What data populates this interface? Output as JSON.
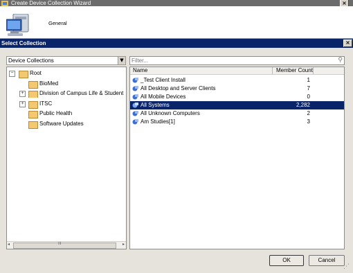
{
  "wizard": {
    "title": "Create Device Collection Wizard",
    "page_label": "General"
  },
  "dialog": {
    "title": "Select Collection"
  },
  "dropdown": {
    "value": "Device Collections"
  },
  "filter": {
    "placeholder": "Filter..."
  },
  "tree": {
    "root": "Root",
    "items": [
      {
        "label": "BioMed",
        "expandable": false
      },
      {
        "label": "Division of Campus Life & Student S",
        "expandable": true
      },
      {
        "label": "ITSC",
        "expandable": true
      },
      {
        "label": "Public Health",
        "expandable": false
      },
      {
        "label": "Software Updates",
        "expandable": false
      }
    ]
  },
  "list": {
    "columns": {
      "name": "Name",
      "count": "Member Count"
    },
    "rows": [
      {
        "name": "_Test Client Install",
        "count": "1"
      },
      {
        "name": "All Desktop and Server Clients",
        "count": "7"
      },
      {
        "name": "All Mobile Devices",
        "count": "0"
      },
      {
        "name": "All Systems",
        "count": "2,282",
        "selected": true
      },
      {
        "name": "All Unknown Computers",
        "count": "2"
      },
      {
        "name": "Am Studies[1]",
        "count": "3"
      }
    ]
  },
  "buttons": {
    "ok": "OK",
    "cancel": "Cancel"
  },
  "scroll_thumb_label": "III",
  "colors": {
    "titlebar": "#0a246a",
    "selection": "#0a246a",
    "folder": "#f4c771"
  }
}
